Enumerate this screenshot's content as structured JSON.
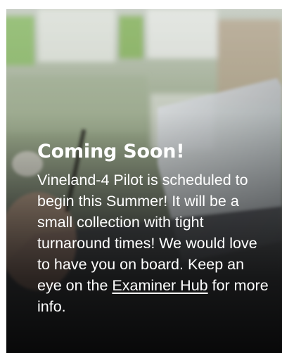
{
  "card": {
    "title": "Coming Soon!",
    "body_before_link": "Vineland-4 Pilot is scheduled to begin this Summer! It will be a small collection with tight turnaround times! We would love to have you on board. Keep an eye on the ",
    "link_text": "Examiner Hub",
    "body_after_link": " for more info.",
    "background_image": "person-using-laptop-photo"
  },
  "colors": {
    "text": "#ffffff",
    "overlay": "#000000"
  }
}
